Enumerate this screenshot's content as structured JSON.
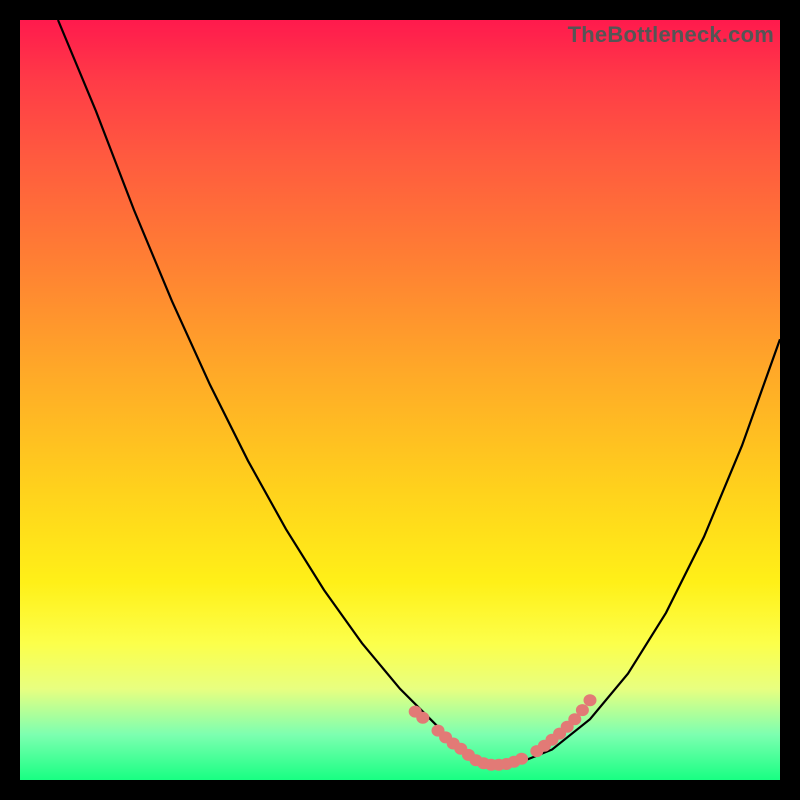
{
  "watermark": "TheBottleneck.com",
  "colors": {
    "frame": "#000000",
    "curve": "#000000",
    "marker_fill": "#E27A76",
    "marker_stroke": "#D45B5B",
    "gradient_top": "#ff1a4d",
    "gradient_bottom": "#18ff83"
  },
  "chart_data": {
    "type": "line",
    "title": "",
    "xlabel": "",
    "ylabel": "",
    "xlim": [
      0,
      100
    ],
    "ylim": [
      0,
      100
    ],
    "grid": false,
    "legend": false,
    "series": [
      {
        "name": "bottleneck-curve",
        "x": [
          5,
          10,
          15,
          20,
          25,
          30,
          35,
          40,
          45,
          50,
          55,
          58,
          60,
          62,
          65,
          70,
          75,
          80,
          85,
          90,
          95,
          100
        ],
        "y": [
          100,
          88,
          75,
          63,
          52,
          42,
          33,
          25,
          18,
          12,
          7,
          4,
          2,
          2,
          2,
          4,
          8,
          14,
          22,
          32,
          44,
          58
        ]
      }
    ],
    "markers": {
      "name": "highlight-points",
      "note": "pink dot segments near trough of curve",
      "x": [
        52,
        53,
        55,
        56,
        57,
        58,
        59,
        60,
        61,
        62,
        63,
        64,
        65,
        66,
        68,
        69,
        70,
        71,
        72,
        73,
        74,
        75
      ],
      "y": [
        9,
        8.2,
        6.5,
        5.6,
        4.8,
        4.1,
        3.3,
        2.6,
        2.2,
        2.0,
        2.0,
        2.1,
        2.4,
        2.8,
        3.8,
        4.5,
        5.3,
        6.1,
        7.0,
        8.0,
        9.2,
        10.5
      ]
    }
  }
}
